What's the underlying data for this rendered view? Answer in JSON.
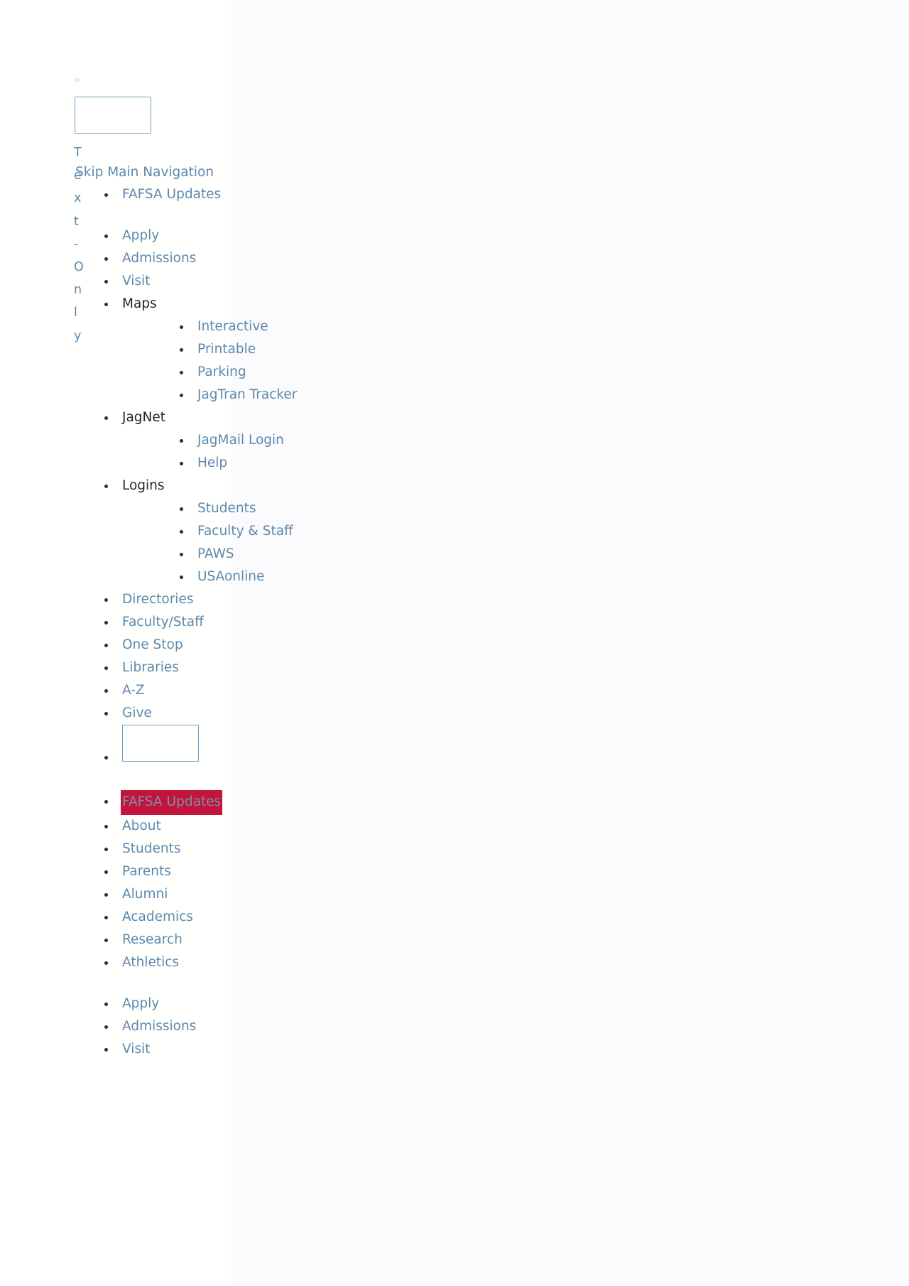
{
  "page": {
    "background": "#fbfbfd",
    "panel_background": "#fffffd",
    "link_color": "#5b89ae",
    "plain_text_color": "#26262a",
    "highlight_background": "#c2143c",
    "highlight_text_color": "#7d8fa5",
    "box_border_color": "#6da0c4"
  },
  "text_only_toggle": {
    "name": "Text-Only",
    "chars": [
      "T",
      "e",
      "x",
      "t",
      "-",
      "O",
      "n",
      "l",
      "y"
    ]
  },
  "search_top": {
    "value": "",
    "placeholder": ""
  },
  "search_inline": {
    "value": "",
    "placeholder": ""
  },
  "skip_link": {
    "label": "Skip Main Navigation"
  },
  "main_nav": [
    {
      "label": "FAFSA Updates",
      "type": "link"
    },
    {
      "label": "Apply",
      "type": "link"
    },
    {
      "label": "Admissions",
      "type": "link"
    },
    {
      "label": "Visit",
      "type": "link"
    },
    {
      "label": "Maps",
      "type": "plain",
      "children": [
        {
          "label": "Interactive",
          "type": "link"
        },
        {
          "label": "Printable",
          "type": "link"
        },
        {
          "label": "Parking",
          "type": "link"
        },
        {
          "label": "JagTran Tracker",
          "type": "link"
        }
      ]
    },
    {
      "label": "JagNet",
      "type": "plain",
      "children": [
        {
          "label": "JagMail Login",
          "type": "link"
        },
        {
          "label": "Help",
          "type": "link"
        }
      ]
    },
    {
      "label": "Logins",
      "type": "plain",
      "children": [
        {
          "label": "Students",
          "type": "link"
        },
        {
          "label": "Faculty & Staff",
          "type": "link"
        },
        {
          "label": "PAWS",
          "type": "link"
        },
        {
          "label": "USAonline",
          "type": "link"
        }
      ]
    },
    {
      "label": "Directories",
      "type": "link"
    },
    {
      "label": "Faculty/Staff",
      "type": "link"
    },
    {
      "label": "One Stop",
      "type": "link"
    },
    {
      "label": "Libraries",
      "type": "link"
    },
    {
      "label": "A-Z",
      "type": "link"
    },
    {
      "label": "Give",
      "type": "link"
    }
  ],
  "secondary_nav": [
    {
      "label": "FAFSA Updates",
      "type": "link",
      "highlighted": true
    },
    {
      "label": "About",
      "type": "link"
    },
    {
      "label": "Students",
      "type": "link"
    },
    {
      "label": "Parents",
      "type": "link"
    },
    {
      "label": "Alumni",
      "type": "link"
    },
    {
      "label": "Academics",
      "type": "link"
    },
    {
      "label": "Research",
      "type": "link"
    },
    {
      "label": "Athletics",
      "type": "link"
    }
  ],
  "tertiary_nav": [
    {
      "label": "Apply",
      "type": "link"
    },
    {
      "label": "Admissions",
      "type": "link"
    },
    {
      "label": "Visit",
      "type": "link"
    }
  ]
}
